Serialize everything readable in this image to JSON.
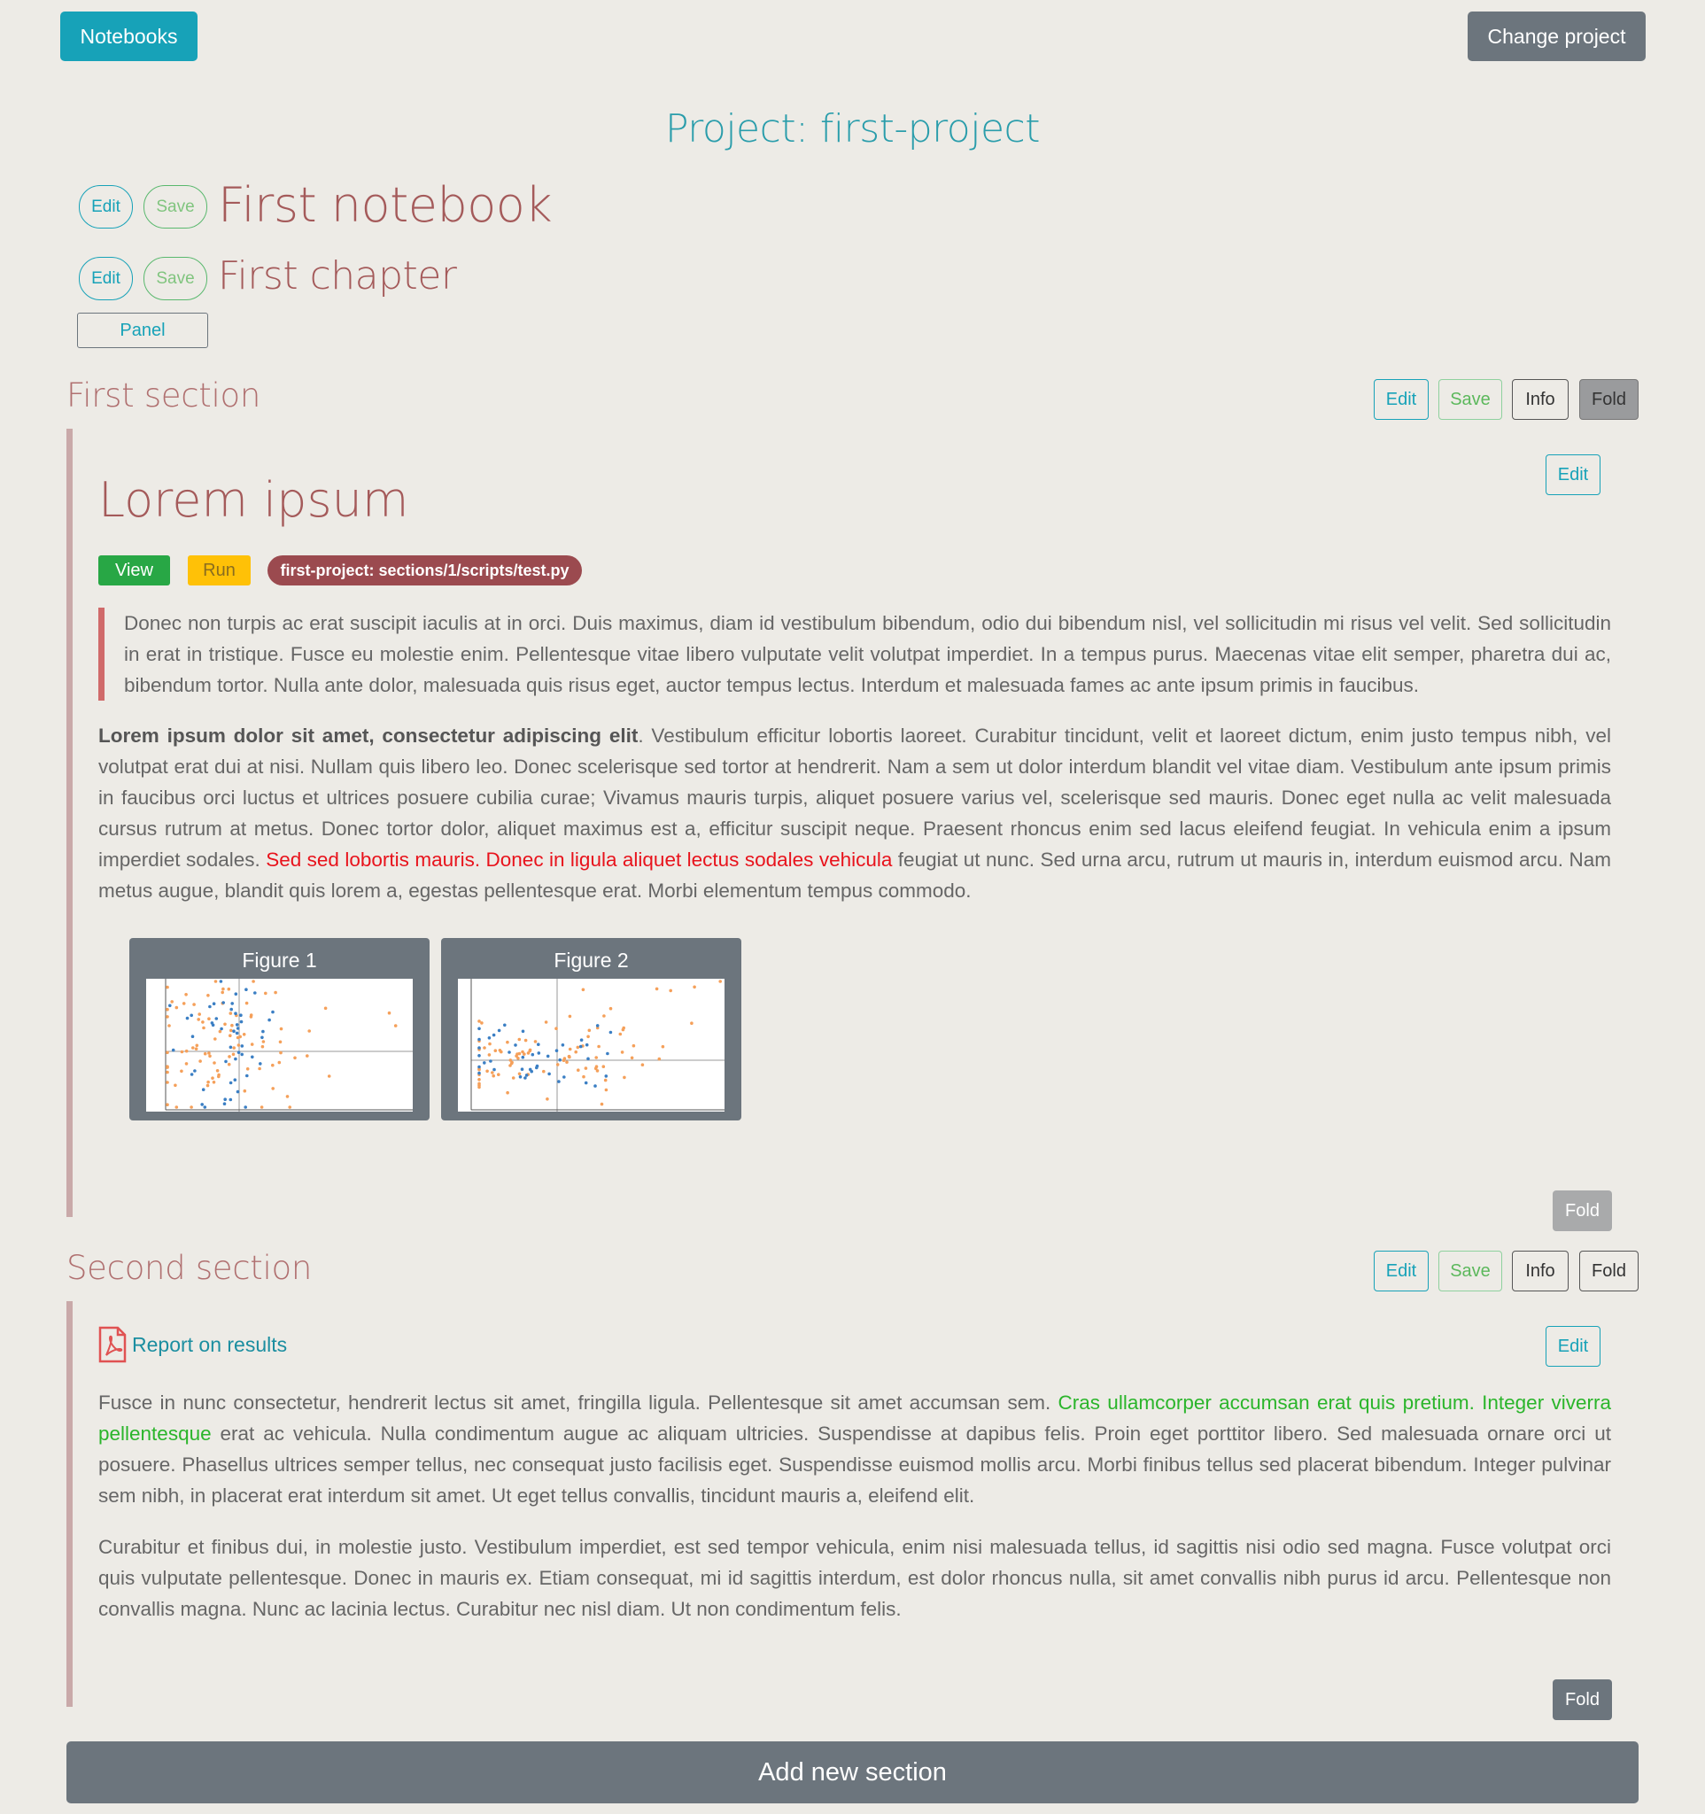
{
  "nav": {
    "notebooks_label": "Notebooks",
    "change_project_label": "Change project"
  },
  "project": {
    "title": "Project: first-project"
  },
  "notebook": {
    "title": "First notebook",
    "edit_label": "Edit",
    "save_label": "Save"
  },
  "chapter": {
    "title": "First chapter",
    "edit_label": "Edit",
    "save_label": "Save",
    "panel_label": "Panel"
  },
  "sections": [
    {
      "title": "First section",
      "buttons": {
        "edit": "Edit",
        "save": "Save",
        "info": "Info",
        "fold": "Fold"
      },
      "block": {
        "edit_label": "Edit",
        "heading": "Lorem ipsum",
        "tags": {
          "view": "View",
          "run": "Run",
          "path": "first-project: sections/1/scripts/test.py"
        },
        "quote": "Donec non turpis ac erat suscipit iaculis at in orci. Duis maximus, diam id vestibulum bibendum, odio dui bibendum nisl, vel sollicitudin mi risus vel velit. Sed sollicitudin in erat in tristique. Fusce eu molestie enim. Pellentesque vitae libero vulputate velit volutpat imperdiet. In a tempus purus. Maecenas vitae elit semper, pharetra dui ac, bibendum tortor. Nulla ante dolor, malesuada quis risus eget, auctor tempus lectus. Interdum et malesuada fames ac ante ipsum primis in faucibus.",
        "para_bold": "Lorem ipsum dolor sit amet, consectetur adipiscing elit",
        "para_part1": ". Vestibulum efficitur lobortis laoreet. Curabitur tincidunt, velit et laoreet dictum, enim justo tempus nibh, vel volutpat erat dui at nisi. Nullam quis libero leo. Donec scelerisque sed tortor at hendrerit. Nam a sem ut dolor interdum blandit vel vitae diam. Vestibulum ante ipsum primis in faucibus orci luctus et ultrices posuere cubilia curae; Vivamus mauris turpis, aliquet posuere varius vel, scelerisque sed mauris. Donec eget nulla ac velit malesuada cursus rutrum at metus. Donec tortor dolor, aliquet maximus est a, efficitur suscipit neque. Praesent rhoncus enim sed lacus eleifend feugiat. In vehicula enim a ipsum imperdiet sodales. ",
        "para_red": "Sed sed lobortis mauris. Donec in ligula aliquet lectus sodales vehicula",
        "para_part2": " feugiat ut nunc. Sed urna arcu, rutrum ut mauris in, interdum euismod arcu. Nam metus augue, blandit quis lorem a, egestas pellentesque erat. Morbi elementum tempus commodo.",
        "figures": [
          {
            "label": "Figure 1"
          },
          {
            "label": "Figure 2"
          }
        ],
        "fold_label": "Fold"
      }
    },
    {
      "title": "Second section",
      "buttons": {
        "edit": "Edit",
        "save": "Save",
        "info": "Info",
        "fold": "Fold"
      },
      "block": {
        "edit_label": "Edit",
        "report_link": "Report on results",
        "para1_part1": "Fusce in nunc consectetur, hendrerit lectus sit amet, fringilla ligula. Pellentesque sit amet accumsan sem. ",
        "para1_green": "Cras ullamcorper accumsan erat quis pretium. Integer viverra pellentesque",
        "para1_part2": " erat ac vehicula. Nulla condimentum augue ac aliquam ultricies. Suspendisse at dapibus felis. Proin eget porttitor libero. Sed malesuada ornare orci ut posuere. Phasellus ultrices semper tellus, nec consequat justo facilisis eget. Suspendisse euismod mollis arcu. Morbi finibus tellus sed placerat bibendum. Integer pulvinar sem nibh, in placerat erat interdum sit amet. Ut eget tellus convallis, tincidunt mauris a, eleifend elit.",
        "para2": "Curabitur et finibus dui, in molestie justo. Vestibulum imperdiet, est sed tempor vehicula, enim nisi malesuada tellus, id sagittis nisi odio sed magna. Fusce volutpat orci quis vulputate pellentesque. Donec in mauris ex. Etiam consequat, mi id sagittis interdum, est dolor rhoncus nulla, sit amet convallis nibh purus id arcu. Pellentesque non convallis magna. Nunc ac lacinia lectus. Curabitur nec nisl diam. Ut non condimentum felis.",
        "fold_label": "Fold"
      }
    }
  ],
  "add_section_label": "Add new section",
  "colors": {
    "info": "#17a2b8",
    "secondary": "#6c757d",
    "accent_title": "#a45a5a",
    "success": "#28a745",
    "warning": "#ffc107"
  },
  "icons": {
    "report": "pdf-file-icon"
  }
}
